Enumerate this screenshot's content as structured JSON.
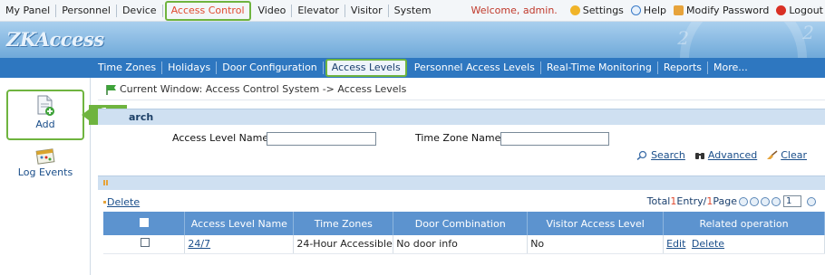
{
  "topbar": {
    "items": [
      "My Panel",
      "Personnel",
      "Device",
      "Access Control",
      "Video",
      "Elevator",
      "Visitor",
      "System"
    ],
    "welcome": "Welcome, admin.",
    "settings": "Settings",
    "help": "Help",
    "modify_password": "Modify Password",
    "logout": "Logout"
  },
  "banner": {
    "logo": "ZKAccess"
  },
  "tabs": [
    "Time Zones",
    "Holidays",
    "Door Configuration",
    "Access Levels",
    "Personnel Access Levels",
    "Real-Time Monitoring",
    "Reports",
    "More..."
  ],
  "sidebar": {
    "add": "Add",
    "log_events": "Log Events"
  },
  "callout": "1",
  "breadcrumb": "Current Window: Access Control System -> Access Levels",
  "search": {
    "title": "arch",
    "access_level_label": "Access Level Name:",
    "access_level_value": "",
    "time_zone_label": "Time Zone Name:",
    "time_zone_value": "",
    "search_btn": "Search",
    "advanced_btn": "Advanced",
    "clear_btn": "Clear"
  },
  "list": {
    "delete": "Delete",
    "total_prefix": "Total ",
    "total_count": "1",
    "total_mid": " Entry/",
    "page_count": "1",
    "page_suffix": " Page",
    "page_input": "1",
    "columns": [
      "Access Level Name",
      "Time Zones",
      "Door Combination",
      "Visitor Access Level",
      "Related operation"
    ],
    "rows": [
      {
        "name": "24/7",
        "time_zone": "24-Hour Accessible",
        "door": "No door info",
        "visitor": "No",
        "edit": "Edit",
        "delete": "Delete"
      }
    ]
  },
  "colors": {
    "accent_green": "#6fb43f",
    "tab_blue": "#2e77c0",
    "active_red": "#e04a2f"
  }
}
